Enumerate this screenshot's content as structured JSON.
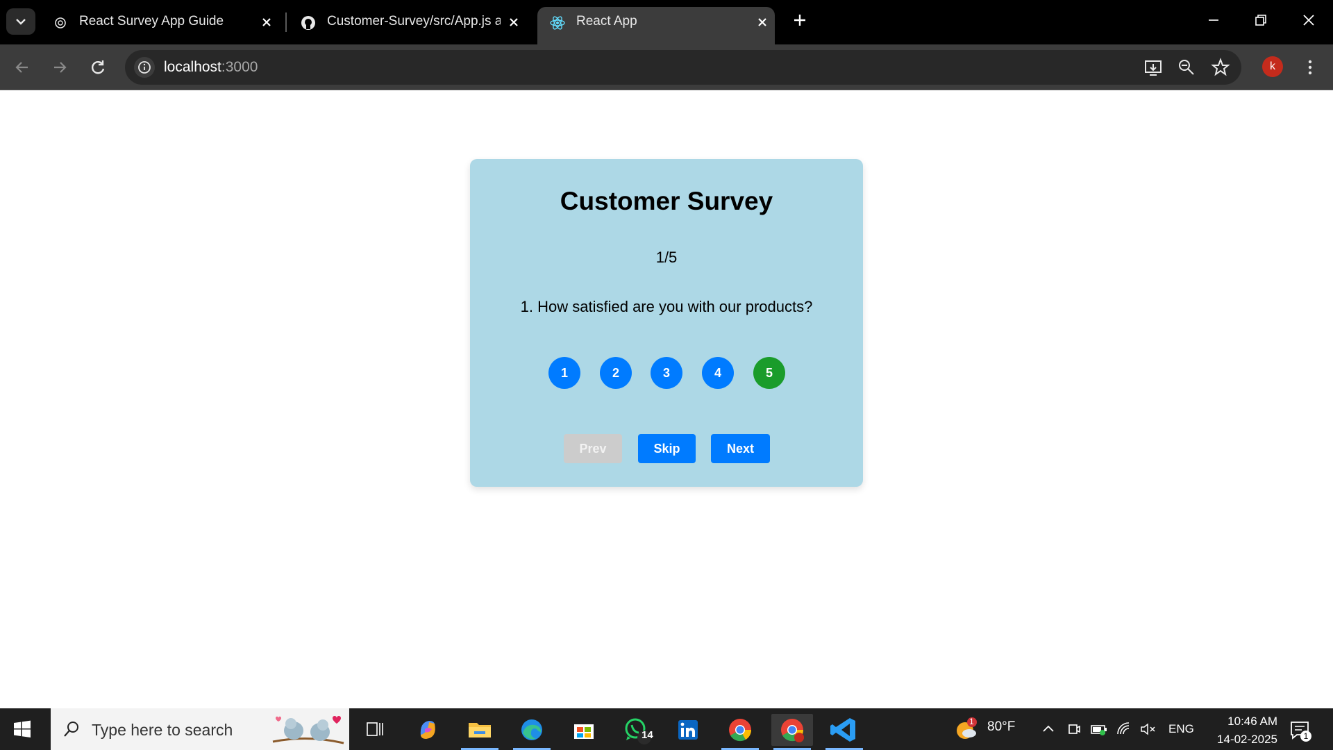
{
  "browser": {
    "tabs": [
      {
        "title": "React Survey App Guide",
        "icon": "openai-icon",
        "active": false
      },
      {
        "title": "Customer-Survey/src/App.js at m",
        "icon": "github-icon",
        "active": false
      },
      {
        "title": "React App",
        "icon": "react-icon",
        "active": true
      }
    ],
    "address": {
      "host": "localhost",
      "port": ":3000"
    },
    "profile_initial": "k"
  },
  "survey": {
    "title": "Customer Survey",
    "progress": "1/5",
    "question": "1. How satisfied are you with our products?",
    "ratings": [
      "1",
      "2",
      "3",
      "4",
      "5"
    ],
    "selected_rating": 5,
    "buttons": {
      "prev": "Prev",
      "skip": "Skip",
      "next": "Next"
    }
  },
  "taskbar": {
    "search_placeholder": "Type here to search",
    "whatsapp_badge": "14",
    "weather": {
      "temp": "80°F",
      "badge": "1"
    },
    "language": "ENG",
    "time": "10:46 AM",
    "date": "14-02-2025",
    "notification_count": "1"
  },
  "colors": {
    "card_bg": "#add8e6",
    "primary": "#007bff",
    "selected": "#1a9c2b",
    "disabled": "#cccccc"
  }
}
